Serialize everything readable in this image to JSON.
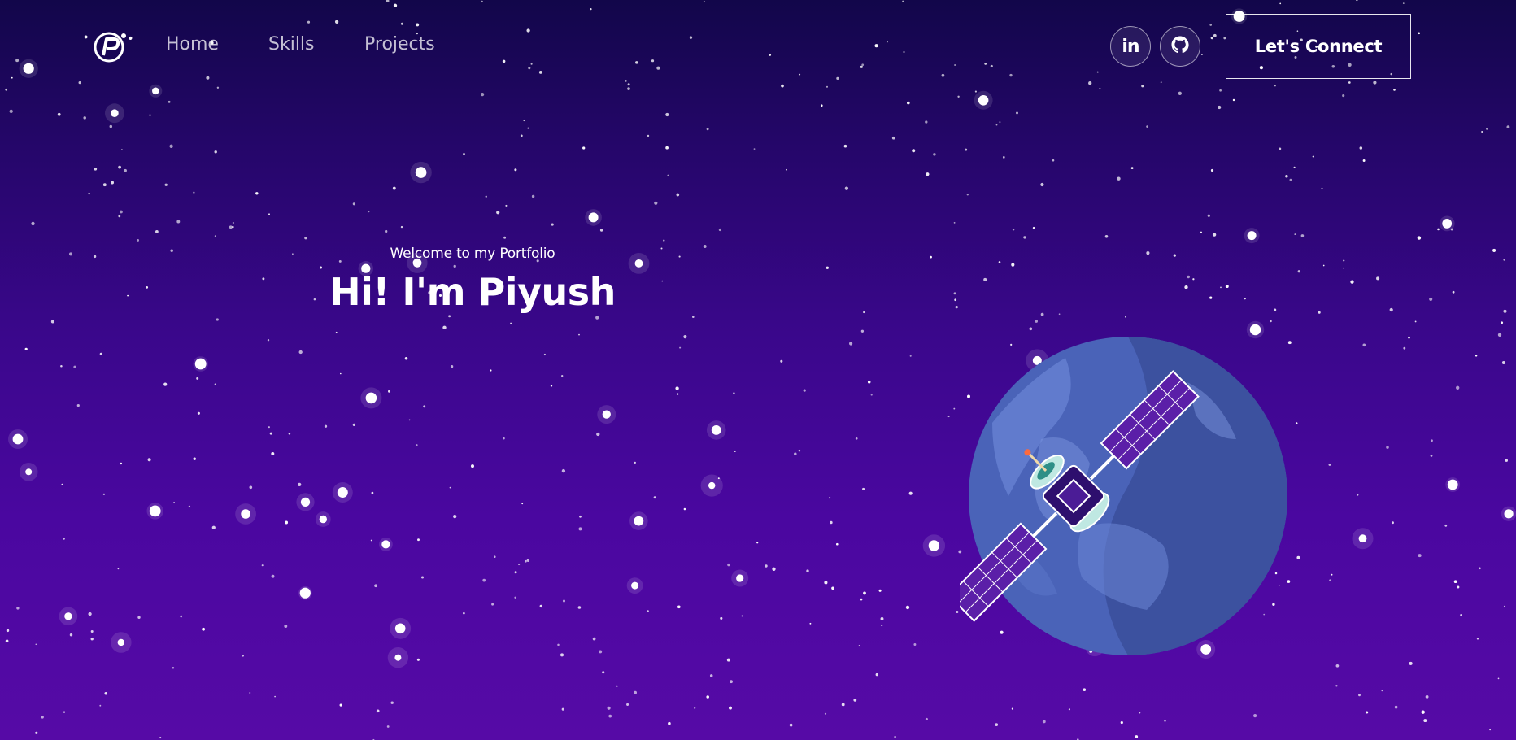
{
  "nav": {
    "logo_icon": "p-logo-icon",
    "links": [
      {
        "label": "Home"
      },
      {
        "label": "Skills"
      },
      {
        "label": "Projects"
      }
    ],
    "social": [
      {
        "name": "linkedin-icon",
        "glyph": "in"
      },
      {
        "name": "github-icon"
      }
    ],
    "cta_label": "Let's Connect"
  },
  "hero": {
    "tagline": "Welcome to my Portfolio",
    "title": "Hi! I'm Piyush"
  },
  "illustration": {
    "planet_icon": "planet-illustration",
    "satellite_icon": "satellite-illustration"
  },
  "colors": {
    "bg_top": "#12064a",
    "bg_bottom": "#560aa6",
    "planet": "#4a63b8",
    "planet_highlight": "#6b86d6",
    "planet_shadow": "#3a4d9a",
    "panel": "#5b1fa8",
    "text": "#ffffff"
  }
}
